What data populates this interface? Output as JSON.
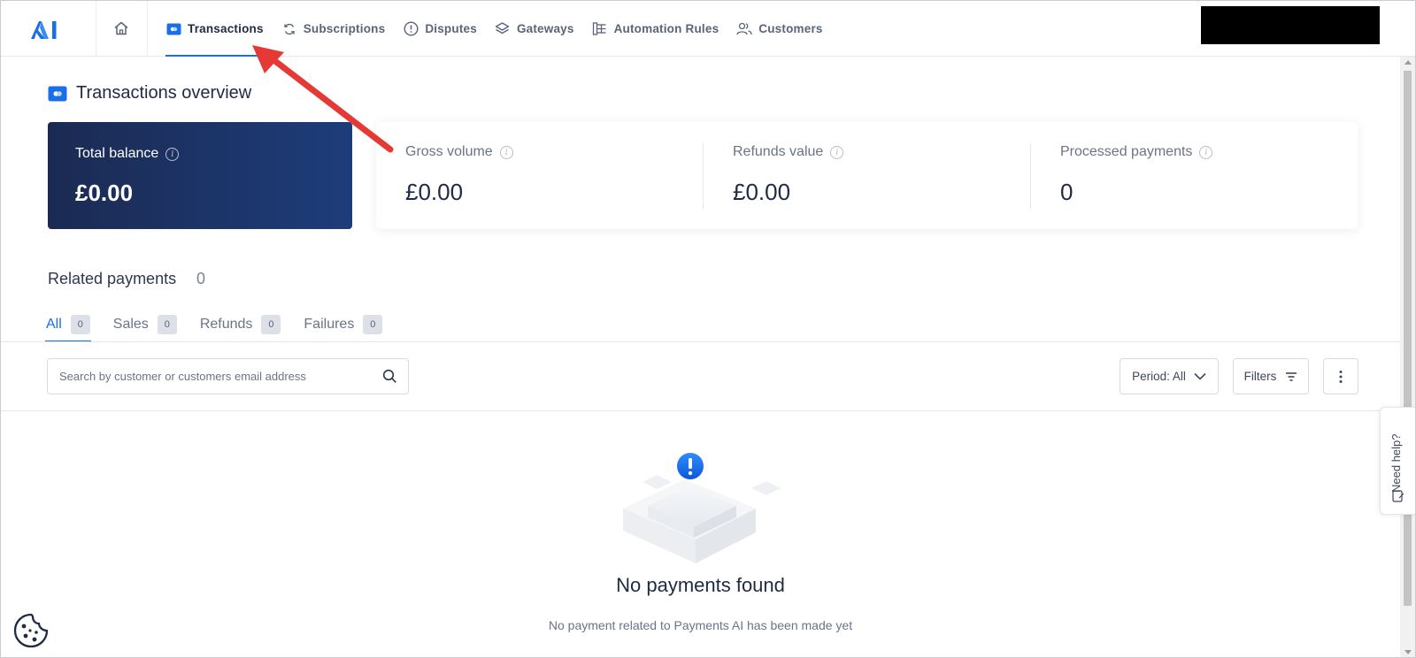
{
  "nav": {
    "logo_text": "AI",
    "items": [
      {
        "label": "Transactions",
        "icon": "transactions-icon",
        "active": true
      },
      {
        "label": "Subscriptions",
        "icon": "refresh-icon",
        "active": false
      },
      {
        "label": "Disputes",
        "icon": "alert-circle-icon",
        "active": false
      },
      {
        "label": "Gateways",
        "icon": "layers-icon",
        "active": false
      },
      {
        "label": "Automation Rules",
        "icon": "flow-icon",
        "active": false
      },
      {
        "label": "Customers",
        "icon": "users-icon",
        "active": false
      }
    ]
  },
  "page": {
    "title": "Transactions overview"
  },
  "balance": {
    "label": "Total balance",
    "value": "£0.00"
  },
  "stats": [
    {
      "label": "Gross volume",
      "value": "£0.00"
    },
    {
      "label": "Refunds value",
      "value": "£0.00"
    },
    {
      "label": "Processed payments",
      "value": "0"
    }
  ],
  "related": {
    "title": "Related payments",
    "count": "0",
    "tabs": [
      {
        "label": "All",
        "count": "0",
        "active": true
      },
      {
        "label": "Sales",
        "count": "0",
        "active": false
      },
      {
        "label": "Refunds",
        "count": "0",
        "active": false
      },
      {
        "label": "Failures",
        "count": "0",
        "active": false
      }
    ]
  },
  "toolbar": {
    "search_placeholder": "Search by customer or customers email address",
    "period_label": "Period: All",
    "filters_label": "Filters"
  },
  "empty": {
    "title": "No payments found",
    "subtitle": "No payment related to Payments AI has been made yet"
  },
  "help": {
    "label": "Need help?"
  },
  "colors": {
    "accent": "#1a6ee8",
    "balance_card_start": "#1b2a52",
    "balance_card_end": "#1d3d7a",
    "annotation_arrow": "#e53935"
  }
}
